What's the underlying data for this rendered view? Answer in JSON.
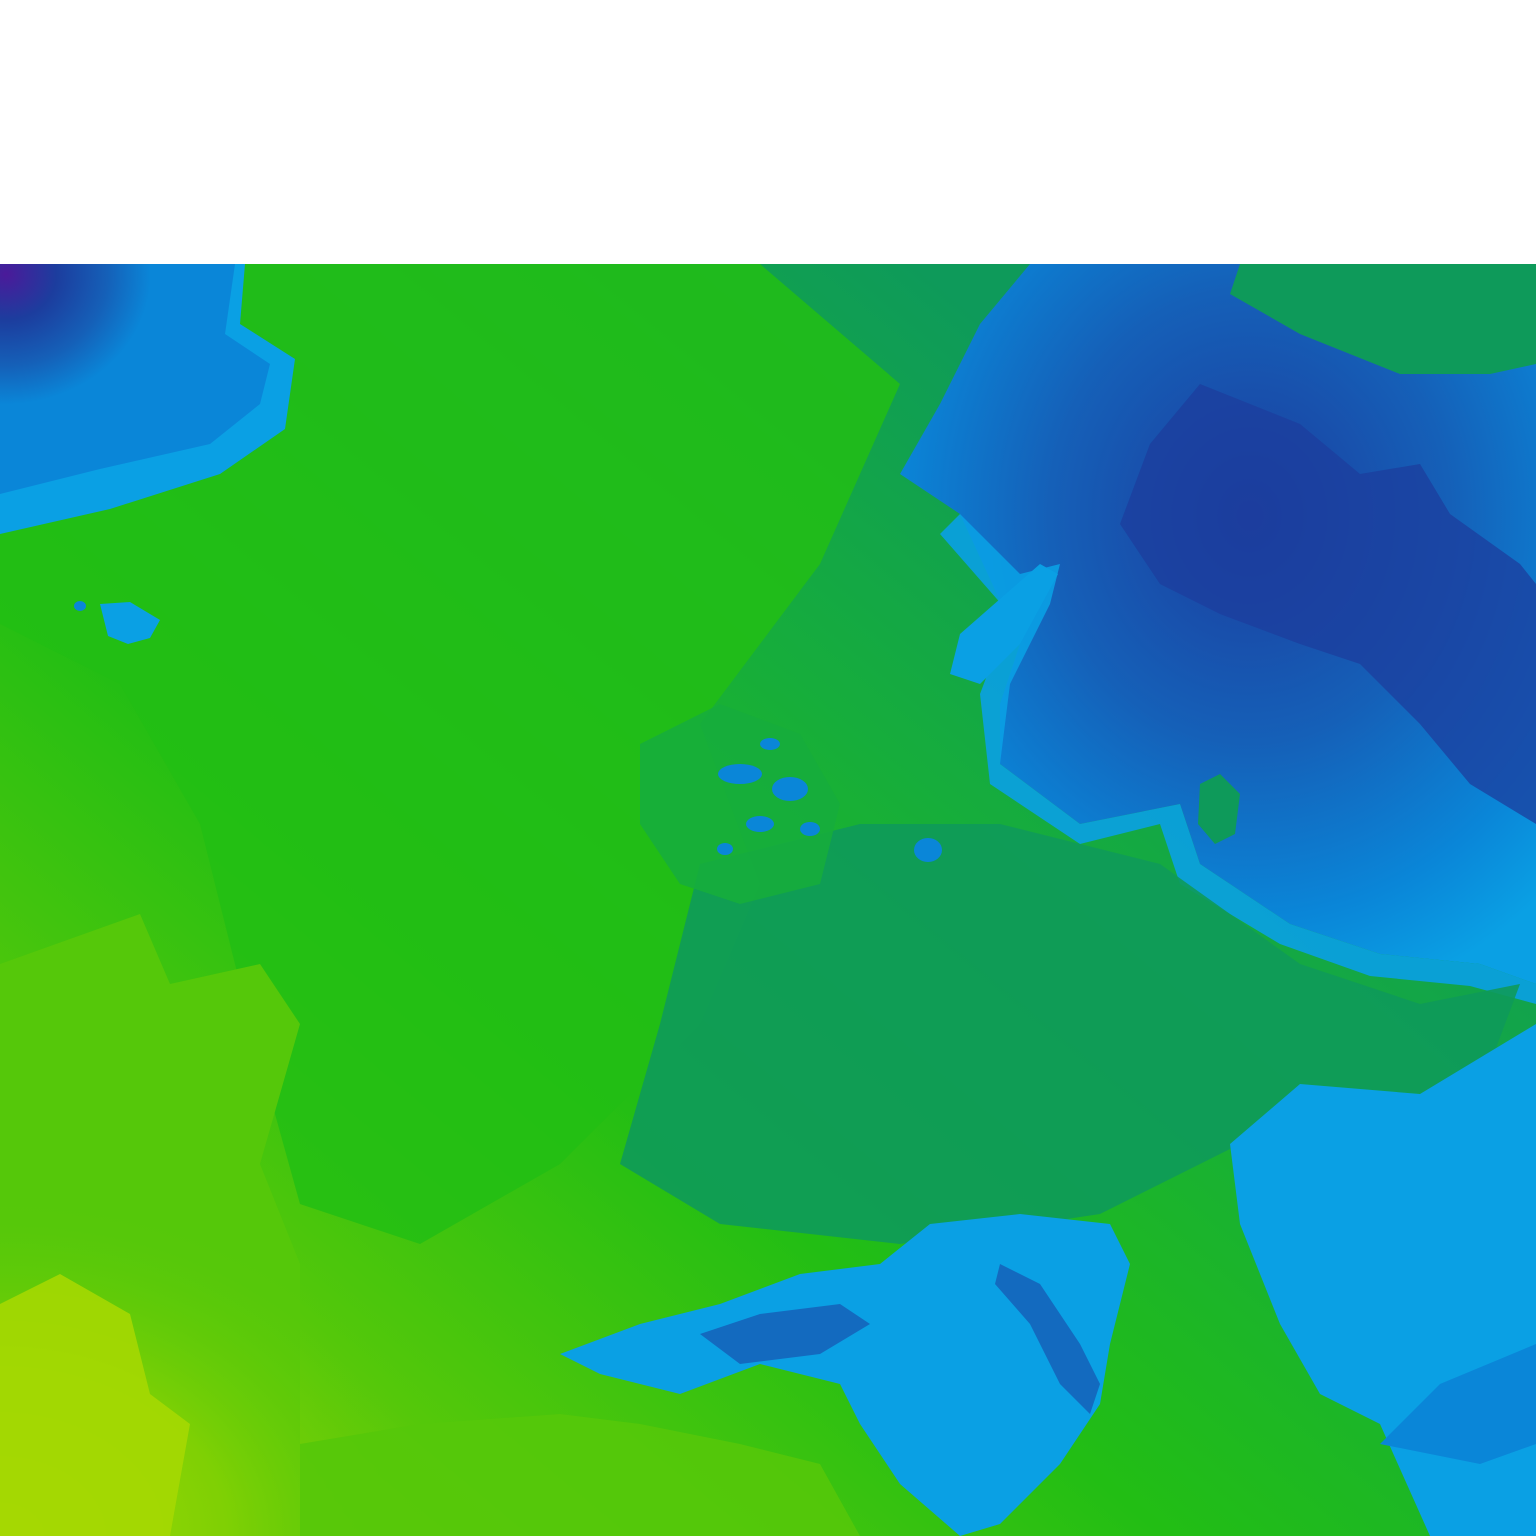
{
  "map": {
    "type": "color-shaded raster tile",
    "colors": {
      "violet": "#4b1a9a",
      "deep_blue": "#1c3d9e",
      "blue": "#1560b8",
      "mid_blue": "#0a86d8",
      "light_blue": "#0aa0e4",
      "teal_green": "#0e9a5a",
      "green": "#16ad3c",
      "bright_green": "#22be14",
      "lime_green": "#55c80a",
      "yellow_green": "#a5d802"
    }
  }
}
